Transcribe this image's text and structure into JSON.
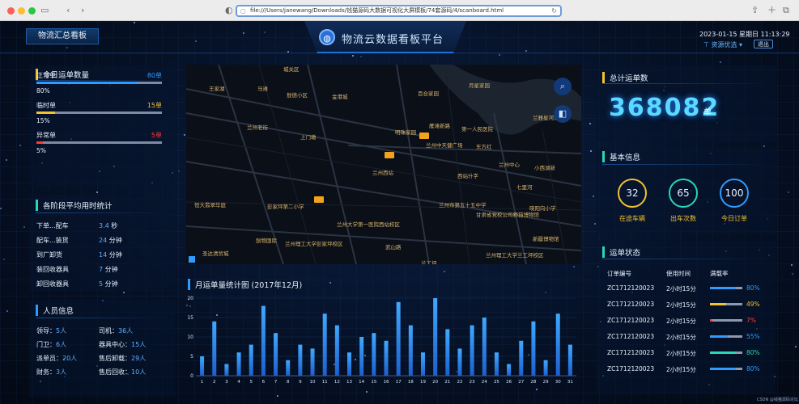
{
  "browser": {
    "url": "file:///Users/janewang/Downloads/钱猫源码大数据可视化大屏模板/74套源码/4/scanboard.html"
  },
  "header": {
    "left_tab": "物流汇总看板",
    "title": "物流云数据看板平台",
    "datetime": "2023-01-15  星期日  11:13:29",
    "prefs_label": "资源优选",
    "logout_label": "退出"
  },
  "today": {
    "title": "今日运单数量",
    "items": [
      {
        "label": "正常单",
        "value": "80单",
        "pct": "80%",
        "fraction": 0.8,
        "color": "#2f9bff"
      },
      {
        "label": "临时单",
        "value": "15单",
        "pct": "15%",
        "fraction": 0.15,
        "color": "#f1c232"
      },
      {
        "label": "异常单",
        "value": "5单",
        "pct": "5%",
        "fraction": 0.05,
        "color": "#ff3b3b"
      }
    ]
  },
  "stage_time": {
    "title": "各阶段平均用时统计",
    "items": [
      {
        "label": "下单...配车",
        "value": "3.4",
        "unit": "秒"
      },
      {
        "label": "配车...装货",
        "value": "24",
        "unit": "分钟"
      },
      {
        "label": "到厂卸货",
        "value": "14",
        "unit": "分钟"
      },
      {
        "label": "装回收器具",
        "value": "7",
        "unit": "分钟"
      },
      {
        "label": "卸回收器具",
        "value": "5",
        "unit": "分钟"
      }
    ]
  },
  "staff": {
    "title": "人员信息",
    "left": [
      {
        "label": "领导：",
        "value": "5人"
      },
      {
        "label": "门卫：",
        "value": "6人"
      },
      {
        "label": "派单员：",
        "value": "20人"
      },
      {
        "label": "财务：",
        "value": "3人"
      }
    ],
    "right": [
      {
        "label": "司机：",
        "value": "36人"
      },
      {
        "label": "器具中心：",
        "value": "15人"
      },
      {
        "label": "售后卸载：",
        "value": "29人"
      },
      {
        "label": "售后回收：",
        "value": "10人"
      }
    ]
  },
  "total": {
    "title": "总计运单数",
    "value": "368082",
    "unit": "单"
  },
  "basic": {
    "title": "基本信息",
    "items": [
      {
        "value": "32",
        "label": "在途车辆",
        "color": "#f1c232"
      },
      {
        "value": "65",
        "label": "出车次数",
        "color": "#29d6b5"
      },
      {
        "value": "100",
        "label": "今日订单",
        "color": "#2f9bff"
      }
    ]
  },
  "status": {
    "title": "运单状态",
    "headers": [
      "订单编号",
      "使用时间",
      "满载率"
    ],
    "rows": [
      {
        "id": "ZC1712120023",
        "time": "2小时15分",
        "pct": "80%",
        "fraction": 0.8,
        "color": "#2f9bff"
      },
      {
        "id": "ZC1712120023",
        "time": "2小时15分",
        "pct": "49%",
        "fraction": 0.49,
        "color": "#f1c232"
      },
      {
        "id": "ZC1712120023",
        "time": "2小时15分",
        "pct": "7%",
        "fraction": 0.07,
        "color": "#ff3b3b"
      },
      {
        "id": "ZC1712120023",
        "time": "2小时15分",
        "pct": "55%",
        "fraction": 0.55,
        "color": "#2f9bff"
      },
      {
        "id": "ZC1712120023",
        "time": "2小时15分",
        "pct": "80%",
        "fraction": 0.8,
        "color": "#29d6b5"
      },
      {
        "id": "ZC1712120023",
        "time": "2小时15分",
        "pct": "80%",
        "fraction": 0.8,
        "color": "#2f9bff"
      }
    ]
  },
  "map": {
    "labels": [
      "城关区",
      "王家湖",
      "马滩",
      "敖德小区",
      "金港城",
      "百合家园",
      "月星家园",
      "兰州老街",
      "上门墩",
      "明珠家园",
      "第一人民医院",
      "兰州中天健广场",
      "东方红",
      "兰雅星河酒店",
      "兰州西站",
      "西站什字",
      "兰州中心",
      "小西湖新",
      "七里河",
      "恒大翡翠华庭",
      "彭家坪第二小学",
      "兰州市第五十五中学",
      "甘肃省党校公司野猫博物馆",
      "晓阳向小学",
      "兰州大学第一医院西站校区",
      "刨物国际",
      "兰州理工大学彭家坪校区",
      "武山路",
      "新疆博物馆",
      "兰州理工大学兰工坪校区",
      "圣达清贸城",
      "兰工坪",
      "雁滩新路"
    ]
  },
  "chart_data": {
    "type": "bar",
    "title": "月运单量统计图 (2017年12月)",
    "categories": [
      "1",
      "2",
      "3",
      "4",
      "5",
      "6",
      "7",
      "8",
      "9",
      "10",
      "11",
      "12",
      "13",
      "14",
      "15",
      "16",
      "17",
      "18",
      "19",
      "20",
      "21",
      "22",
      "23",
      "24",
      "25",
      "26",
      "27",
      "28",
      "29",
      "30",
      "31"
    ],
    "values": [
      5,
      14,
      3,
      6,
      8,
      18,
      11,
      4,
      8,
      7,
      16,
      13,
      6,
      10,
      11,
      9,
      19,
      13,
      6,
      20,
      12,
      7,
      13,
      15,
      6,
      3,
      9,
      14,
      4,
      16,
      8
    ],
    "ylim": [
      0,
      20
    ],
    "yticks": [
      0,
      5,
      10,
      15,
      20
    ]
  },
  "footer": {
    "note": "CSDN @钱猫源码论坛"
  }
}
